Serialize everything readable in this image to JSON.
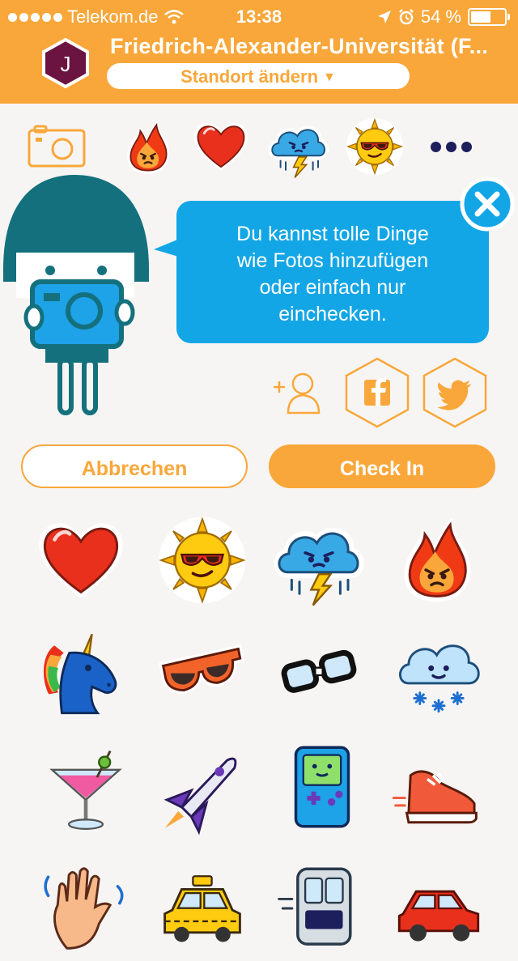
{
  "status_bar": {
    "carrier": "Telekom.de",
    "time": "13:38",
    "battery": "54 %",
    "battery_level": 0.54
  },
  "header": {
    "avatar_letter": "J",
    "place_title": "Friedrich-Alexander-Universität (F...",
    "change_location_label": "Standort ändern"
  },
  "toolbar": {
    "items": [
      "camera-icon",
      "fire-sticker",
      "heart-sticker",
      "storm-cloud-sticker",
      "sun-sticker",
      "more-icon"
    ]
  },
  "tip": {
    "line1": "Du kannst tolle Dinge",
    "line2": "wie Fotos hinzufügen",
    "line3": "oder einfach nur",
    "line4": "einchecken."
  },
  "share": {
    "icons": [
      "add-friend-icon",
      "facebook-icon",
      "twitter-icon"
    ]
  },
  "actions": {
    "cancel_label": "Abbrechen",
    "checkin_label": "Check In"
  },
  "stickers": [
    "heart",
    "sun-with-sunglasses",
    "storm-cloud",
    "fire",
    "unicorn",
    "sunglasses",
    "nerd-glasses",
    "snow-cloud",
    "cocktail",
    "space-shuttle",
    "game-boy",
    "sneaker",
    "waving-hand",
    "taxi",
    "train",
    "red-car"
  ],
  "colors": {
    "brand_orange": "#f9a73a",
    "bubble_blue": "#13a6e6",
    "mascot_teal": "#14707d",
    "navy": "#1d1f5c",
    "background": "#f7f5f4"
  }
}
